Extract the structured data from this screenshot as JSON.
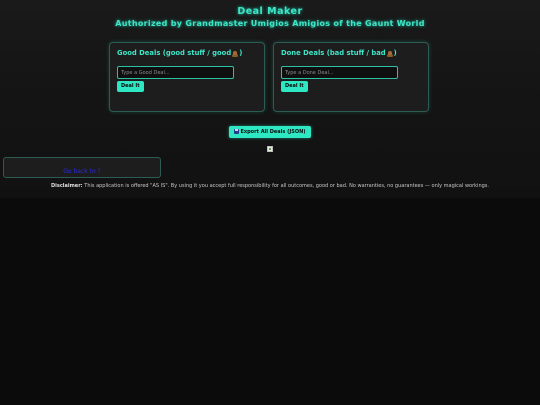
{
  "header": {
    "title": "Deal Maker",
    "subtitle": "Authorized by Grandmaster Umigios Amigios of the Gaunt World"
  },
  "good_panel": {
    "title_prefix": "Good Deals (good stuff / good ",
    "title_suffix": ")",
    "icon": "poop-emoji",
    "input_placeholder": "Type a Good Deal...",
    "button_label": "Deal It"
  },
  "done_panel": {
    "title_prefix": "Done Deals (bad stuff / bad ",
    "title_suffix": ")",
    "icon": "poop-emoji",
    "input_placeholder": "Type a Done Deal...",
    "button_label": "Deal It"
  },
  "export": {
    "icon": "floppy-disk",
    "label": "Export All Deals (JSON)"
  },
  "link": {
    "label": "Go back to ?"
  },
  "disclaimer": {
    "label": "Disclaimer:",
    "text": " This application is offered \"AS IS\". By using it you accept full responsibility for all outcomes, good or bad. No warranties, no guarantees — only magical workings."
  },
  "colors": {
    "accent": "#3ee6c8",
    "button": "#2ee8c4",
    "background": "#0b0b0b",
    "panel": "#1d1d1d",
    "link": "#2a2ad8"
  }
}
